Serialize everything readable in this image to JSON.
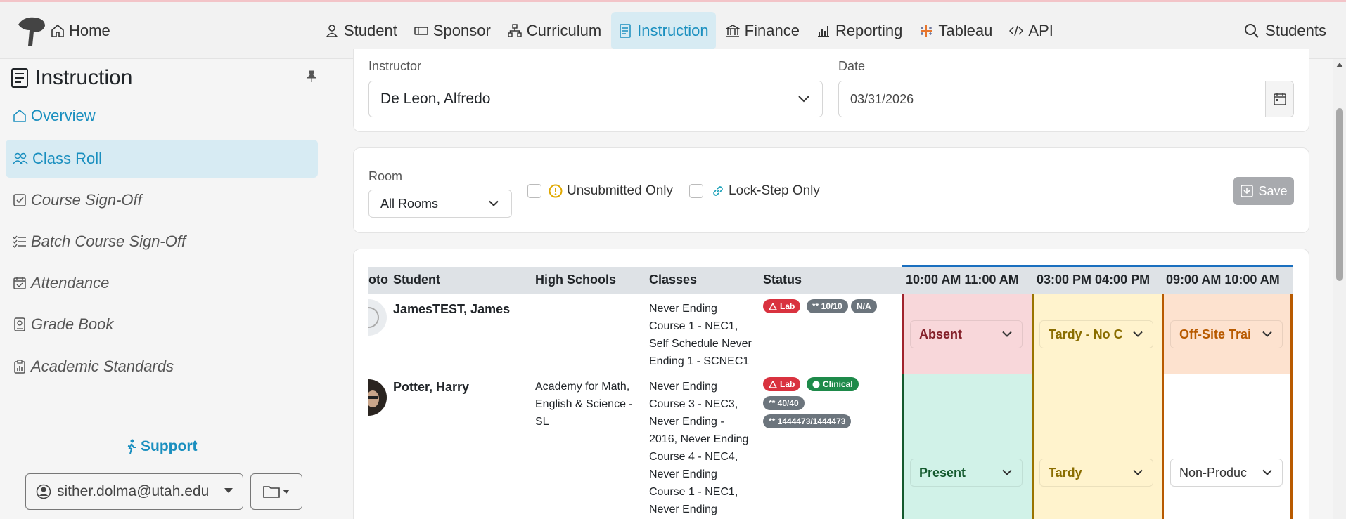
{
  "nav": {
    "home": "Home",
    "items": [
      {
        "label": "Student",
        "icon": "person-icon"
      },
      {
        "label": "Sponsor",
        "icon": "ticket-icon"
      },
      {
        "label": "Curriculum",
        "icon": "diagram-icon"
      },
      {
        "label": "Instruction",
        "icon": "journal-icon",
        "active": true
      },
      {
        "label": "Finance",
        "icon": "bank-icon"
      },
      {
        "label": "Reporting",
        "icon": "bar-chart-icon"
      },
      {
        "label": "Tableau",
        "icon": "tableau-icon"
      },
      {
        "label": "API",
        "icon": "code-icon"
      }
    ],
    "search": "Students"
  },
  "sidebar": {
    "title": "Instruction",
    "items": [
      {
        "label": "Overview",
        "icon": "house-icon"
      },
      {
        "label": "Class Roll",
        "icon": "people-icon"
      },
      {
        "label": "Course Sign-Off",
        "icon": "check-square-icon"
      },
      {
        "label": "Batch Course Sign-Off",
        "icon": "list-check-icon"
      },
      {
        "label": "Attendance",
        "icon": "calendar-check-icon"
      },
      {
        "label": "Grade Book",
        "icon": "book-icon"
      },
      {
        "label": "Academic Standards",
        "icon": "clipboard-chart-icon"
      }
    ],
    "support": "Support",
    "user": "sither.dolma@utah.edu"
  },
  "filters": {
    "instructor_label": "Instructor",
    "instructor_value": "De Leon, Alfredo",
    "date_label": "Date",
    "date_value": "03/31/2026",
    "room_label": "Room",
    "room_value": "All Rooms",
    "unsubmitted_label": "Unsubmitted Only",
    "lockstep_label": "Lock-Step Only",
    "save_label": "Save"
  },
  "table": {
    "headers": {
      "photo": "oto",
      "student": "Student",
      "high_schools": "High Schools",
      "classes": "Classes",
      "status": "Status",
      "slot1": "10:00 AM 11:00 AM",
      "slot2": "03:00 PM 04:00 PM",
      "slot3": "09:00 AM 10:00 AM"
    },
    "rows": [
      {
        "student": "JamesTEST, James",
        "high_school": "",
        "classes": [
          "Never Ending",
          "Course 1 - NEC1,",
          "Self Schedule Never",
          "Ending 1 - SCNEC1"
        ],
        "badges": [
          "Lab",
          "** 10/10",
          "N/A"
        ],
        "att": [
          "Absent",
          "Tardy - No C",
          "Off-Site Trai"
        ]
      },
      {
        "student": "Potter, Harry",
        "high_school": [
          "Academy for Math,",
          "English & Science -",
          "SL"
        ],
        "classes": [
          "Never Ending",
          "Course 3 - NEC3,",
          "Never Ending -",
          "2016, Never Ending",
          "Course 4 - NEC4,",
          "Never Ending",
          "Course 1 - NEC1,",
          "Never Ending"
        ],
        "badges": [
          "Lab",
          "Clinical",
          "** 40/40",
          "** 1444473/1444473"
        ],
        "att": [
          "Present",
          "Tardy",
          "Non-Produc"
        ]
      }
    ]
  }
}
